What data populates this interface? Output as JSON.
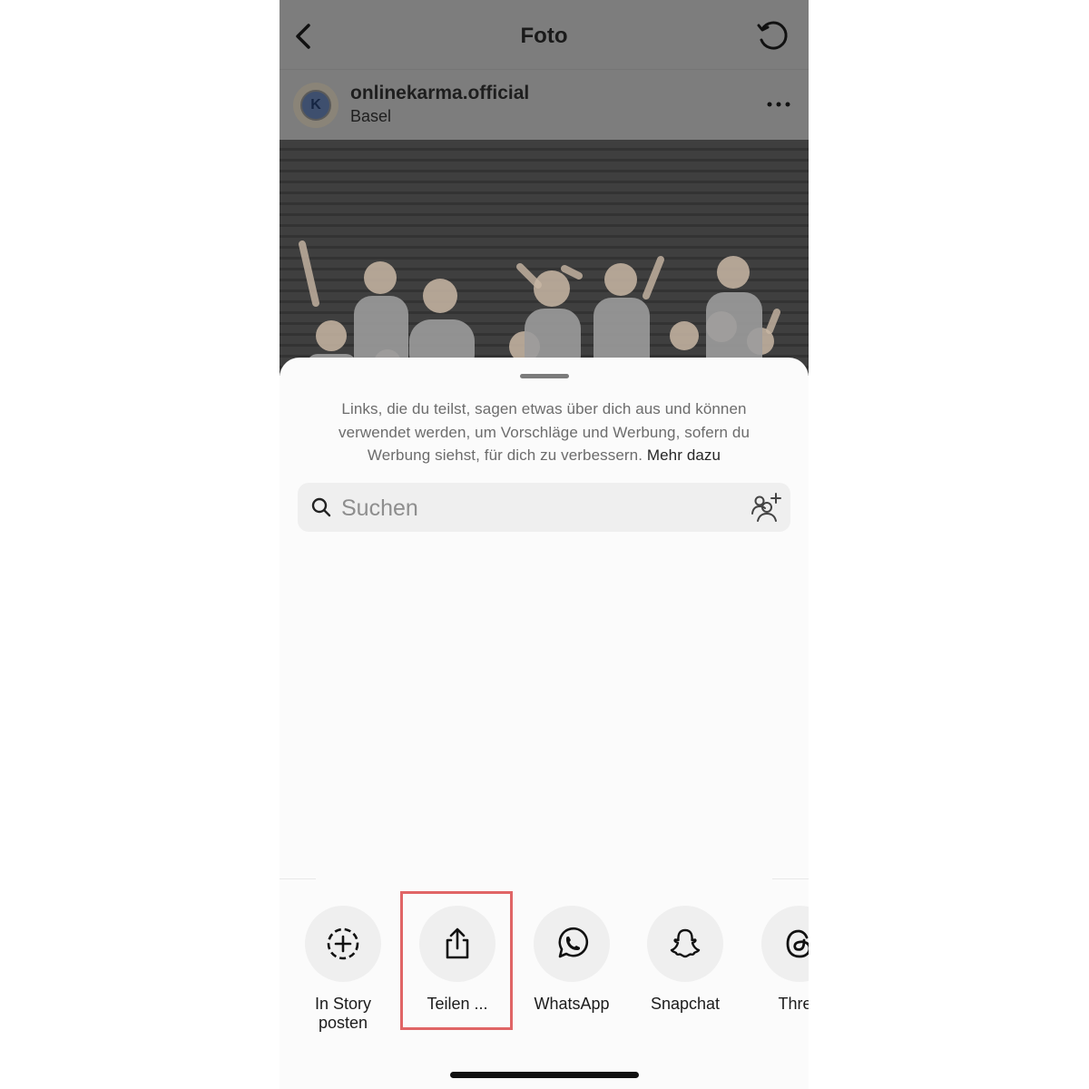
{
  "header": {
    "title": "Foto",
    "back_icon": "chevron-left-icon",
    "refresh_icon": "refresh-icon"
  },
  "post": {
    "username": "onlinekarma.official",
    "location": "Basel",
    "avatar_letter": "K",
    "more_icon": "ellipsis-icon"
  },
  "share_sheet": {
    "disclaimer": "Links, die du teilst, sagen etwas über dich aus und können verwendet werden, um Vorschläge und Werbung, sofern du Werbung siehst, für dich zu verbessern.",
    "learn_more": "Mehr dazu",
    "search": {
      "placeholder": "Suchen",
      "value": ""
    },
    "share_options": [
      {
        "label": "In Story posten",
        "icon": "add-story-icon"
      },
      {
        "label": "Teilen ...",
        "icon": "share-upload-icon"
      },
      {
        "label": "WhatsApp",
        "icon": "whatsapp-icon"
      },
      {
        "label": "Snapchat",
        "icon": "snapchat-icon"
      },
      {
        "label": "Threa",
        "icon": "threads-icon"
      }
    ],
    "highlight_color": "#e06566"
  }
}
